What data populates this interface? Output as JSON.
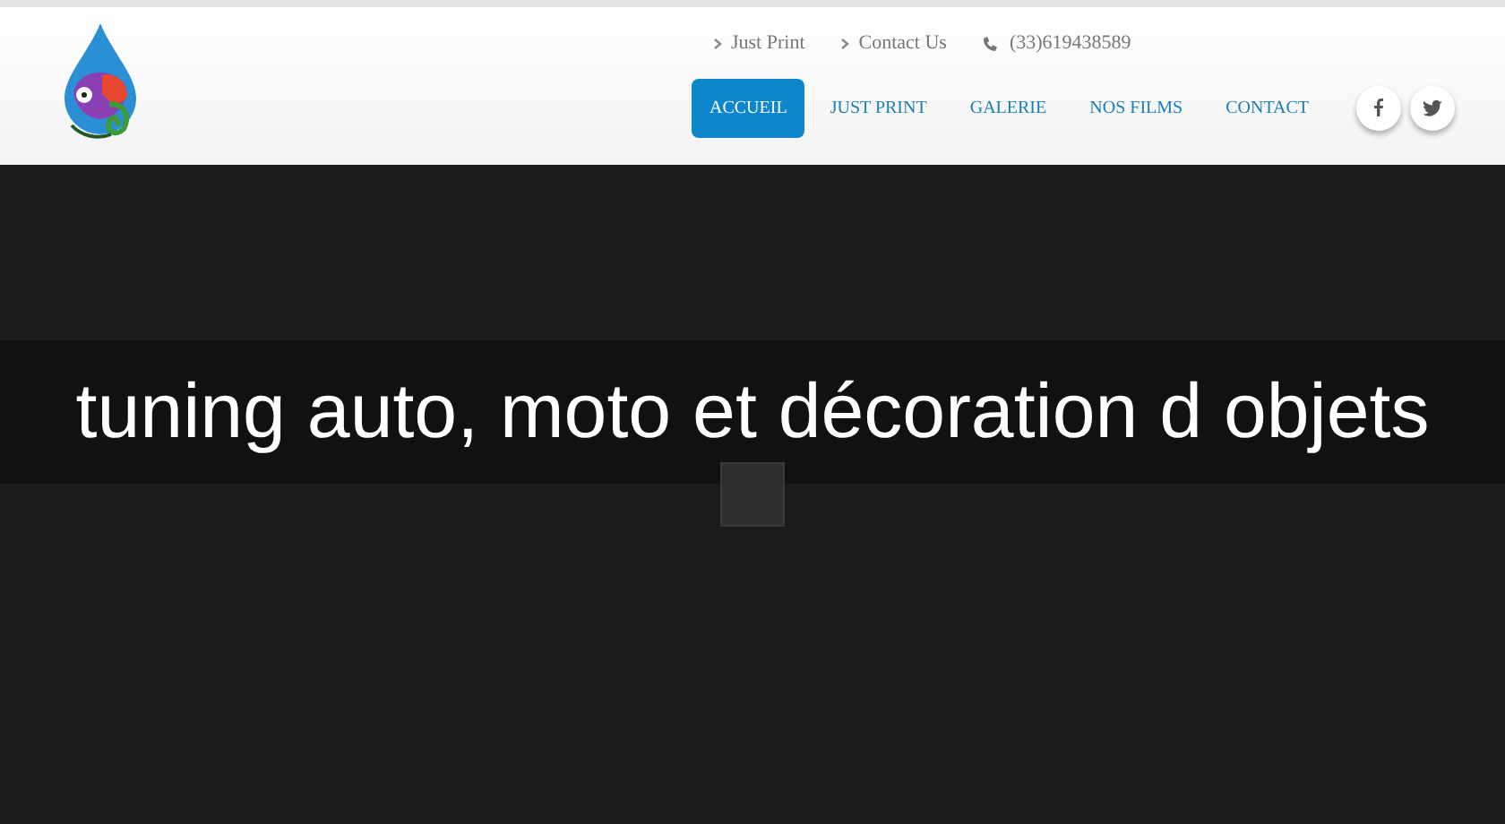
{
  "top_links": [
    {
      "label": "Just Print"
    },
    {
      "label": "Contact Us"
    }
  ],
  "phone": "(33)619438589",
  "nav": [
    {
      "label": "ACCUEIL",
      "selected": true
    },
    {
      "label": "JUST PRINT",
      "selected": false
    },
    {
      "label": "GALERIE",
      "selected": false
    },
    {
      "label": "NOS FILMS",
      "selected": false
    },
    {
      "label": "CONTACT",
      "selected": false
    }
  ],
  "banner": {
    "title": "tuning auto, moto et décoration d objets"
  }
}
